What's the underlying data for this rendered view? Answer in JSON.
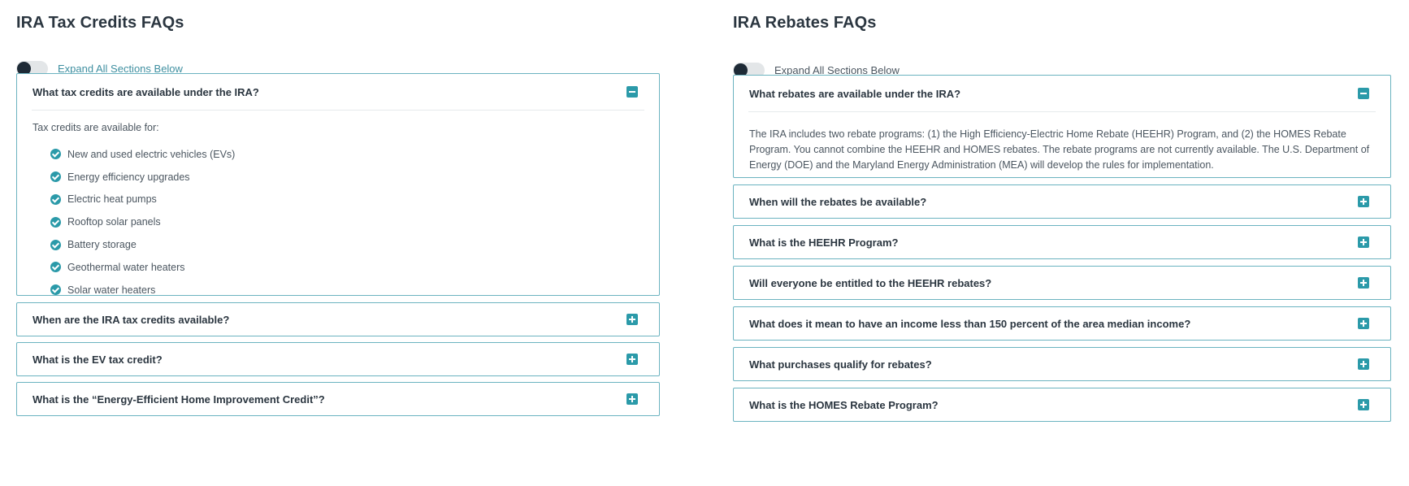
{
  "left": {
    "title": "IRA Tax Credits FAQs",
    "toggle_label": "Expand All Sections Below",
    "open": {
      "question": "What tax credits are available under the IRA?",
      "intro": "Tax credits are available for:",
      "items": [
        "New and used electric vehicles (EVs)",
        "Energy efficiency upgrades",
        "Electric heat pumps",
        "Rooftop solar panels",
        "Battery storage",
        "Geothermal water heaters",
        "Solar water heaters"
      ]
    },
    "collapsed": [
      "When are the IRA tax credits available?",
      "What is the EV tax credit?",
      "What is the “Energy-Efficient Home Improvement Credit”?"
    ]
  },
  "right": {
    "title": "IRA Rebates FAQs",
    "toggle_label": "Expand All Sections Below",
    "open": {
      "question": "What rebates are available under the IRA?",
      "answer": "The IRA includes two rebate programs: (1) the High Efficiency-Electric Home Rebate (HEEHR) Program, and (2) the HOMES Rebate Program. You cannot combine the HEEHR and HOMES rebates. The rebate programs are not currently available. The U.S. Department of Energy (DOE) and the Maryland Energy Administration (MEA) will develop the rules for implementation."
    },
    "collapsed": [
      "When will the rebates be available?",
      "What is the HEEHR Program?",
      "Will everyone be entitled to the HEEHR rebates?",
      "What does it mean to have an income less than 150 percent of the area median income?",
      "What purchases qualify for rebates?",
      "What is the HOMES Rebate Program?"
    ]
  },
  "colors": {
    "accent": "#2b9aa9",
    "border": "#6bb3c0",
    "toggle_knob": "#1e2a36"
  },
  "icons": {
    "expanded": "minus-square-icon",
    "collapsed": "plus-square-icon",
    "list_bullet": "check-circle-icon"
  }
}
